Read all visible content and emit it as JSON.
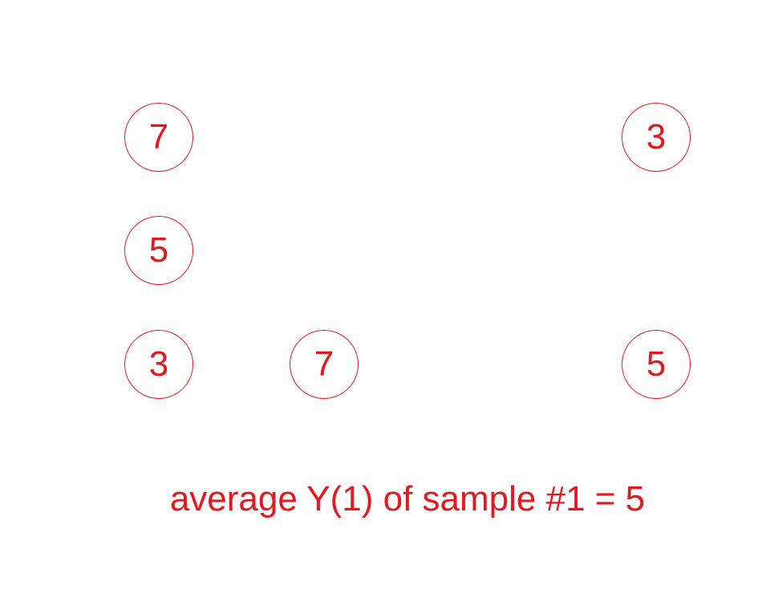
{
  "diagram": {
    "color": "#e5181e",
    "units": [
      {
        "id": "u1",
        "value": "7"
      },
      {
        "id": "u2",
        "value": "3"
      },
      {
        "id": "u3",
        "value": "5"
      },
      {
        "id": "u4",
        "value": "3"
      },
      {
        "id": "u5",
        "value": "7"
      },
      {
        "id": "u6",
        "value": "5"
      }
    ],
    "caption": "average Y(1) of sample #1 = 5"
  }
}
